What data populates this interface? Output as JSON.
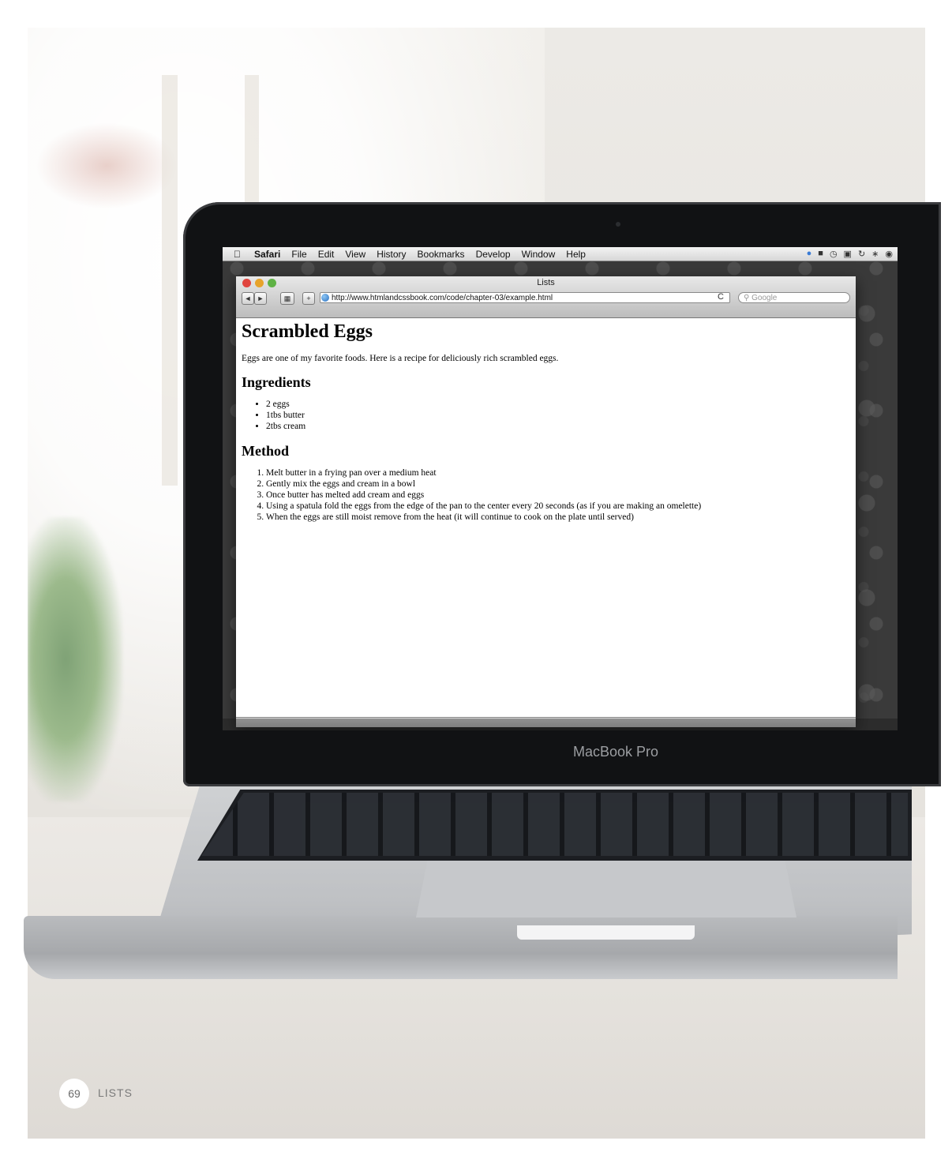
{
  "menubar": {
    "apple_icon": "apple-logo-icon",
    "items": [
      "Safari",
      "File",
      "Edit",
      "View",
      "History",
      "Bookmarks",
      "Develop",
      "Window",
      "Help"
    ],
    "status_icons": [
      "dropbox-icon",
      "evernote-icon",
      "time-machine-icon",
      "display-icon",
      "sync-icon",
      "bluetooth-icon",
      "wifi-icon"
    ]
  },
  "browser": {
    "window_title": "Lists",
    "url": "http://www.htmlandcssbook.com/code/chapter-03/example.html",
    "search_placeholder": "Google",
    "buttons": {
      "back": "◄",
      "forward": "►",
      "add_bookmark": "+",
      "reload": "C"
    }
  },
  "page": {
    "title": "Scrambled Eggs",
    "intro": "Eggs are one of my favorite foods. Here is a recipe for deliciously rich scrambled eggs.",
    "ingredients_heading": "Ingredients",
    "ingredients": [
      "2 eggs",
      "1tbs butter",
      "2tbs cream"
    ],
    "method_heading": "Method",
    "method": [
      "Melt butter in a frying pan over a medium heat",
      "Gently mix the eggs and cream in a bowl",
      "Once butter has melted add cream and eggs",
      "Using a spatula fold the eggs from the edge of the pan to the center every 20 seconds (as if you are making an omelette)",
      "When the eggs are still moist remove from the heat (it will continue to cook on the plate until served)"
    ]
  },
  "laptop": {
    "brand_label": "MacBook Pro"
  },
  "footer": {
    "page_number": "69",
    "section": "LISTS"
  }
}
